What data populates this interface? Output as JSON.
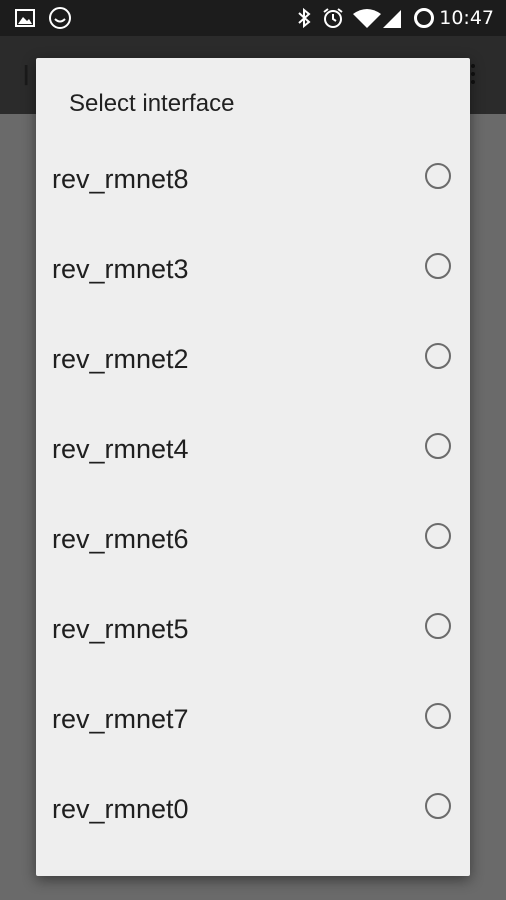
{
  "status_bar": {
    "time": "10:47",
    "icons": [
      "image-icon",
      "smiley-icon",
      "bluetooth-icon",
      "alarm-icon",
      "wifi-icon",
      "signal-icon",
      "battery-ring-icon"
    ]
  },
  "app_bar": {
    "title_fragment": "I"
  },
  "dialog": {
    "title": "Select interface",
    "options": [
      {
        "label": "rev_rmnet8",
        "selected": false
      },
      {
        "label": "rev_rmnet3",
        "selected": false
      },
      {
        "label": "rev_rmnet2",
        "selected": false
      },
      {
        "label": "rev_rmnet4",
        "selected": false
      },
      {
        "label": "rev_rmnet6",
        "selected": false
      },
      {
        "label": "rev_rmnet5",
        "selected": false
      },
      {
        "label": "rev_rmnet7",
        "selected": false
      },
      {
        "label": "rev_rmnet0",
        "selected": false
      }
    ]
  },
  "colors": {
    "dialog_bg": "#eeeeee",
    "scrim": "#6a6a6a",
    "status_bar": "#1c1c1c",
    "radio_outline": "#6b6b6b"
  }
}
